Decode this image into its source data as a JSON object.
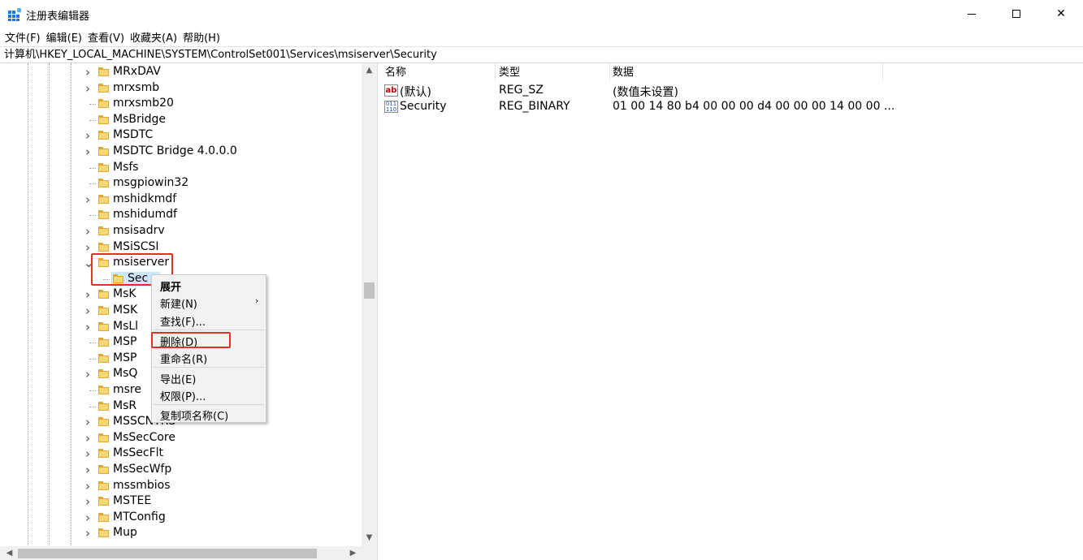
{
  "window": {
    "title": "注册表编辑器"
  },
  "menu": [
    {
      "label": "文件(F)"
    },
    {
      "label": "编辑(E)"
    },
    {
      "label": "查看(V)"
    },
    {
      "label": "收藏夹(A)"
    },
    {
      "label": "帮助(H)"
    }
  ],
  "address": "计算机\\HKEY_LOCAL_MACHINE\\SYSTEM\\ControlSet001\\Services\\msiserver\\Security",
  "tree": {
    "nodes": [
      {
        "label": "MRxDAV",
        "expander": "›"
      },
      {
        "label": "mrxsmb",
        "expander": "›"
      },
      {
        "label": "mrxsmb20",
        "expander": ""
      },
      {
        "label": "MsBridge",
        "expander": ""
      },
      {
        "label": "MSDTC",
        "expander": "›"
      },
      {
        "label": "MSDTC Bridge 4.0.0.0",
        "expander": "›"
      },
      {
        "label": "Msfs",
        "expander": ""
      },
      {
        "label": "msgpiowin32",
        "expander": ""
      },
      {
        "label": "mshidkmdf",
        "expander": "›"
      },
      {
        "label": "mshidumdf",
        "expander": ""
      },
      {
        "label": "msisadrv",
        "expander": "›"
      },
      {
        "label": "MSiSCSI",
        "expander": "›"
      },
      {
        "label": "msiserver",
        "expander": "⌄"
      },
      {
        "label": "Sec",
        "expander": "",
        "child": true,
        "selected": true
      },
      {
        "label": "MsK",
        "expander": "›"
      },
      {
        "label": "MSK",
        "expander": "›"
      },
      {
        "label": "MsLl",
        "expander": "›"
      },
      {
        "label": "MSP",
        "expander": ""
      },
      {
        "label": "MSP",
        "expander": ""
      },
      {
        "label": "MsQ",
        "expander": "›"
      },
      {
        "label": "msre",
        "expander": ""
      },
      {
        "label": "MsR",
        "expander": ""
      },
      {
        "label": "MSSCNTRS",
        "expander": "›"
      },
      {
        "label": "MsSecCore",
        "expander": "›"
      },
      {
        "label": "MsSecFlt",
        "expander": "›"
      },
      {
        "label": "MsSecWfp",
        "expander": "›"
      },
      {
        "label": "mssmbios",
        "expander": "›"
      },
      {
        "label": "MSTEE",
        "expander": "›"
      },
      {
        "label": "MTConfig",
        "expander": "›"
      },
      {
        "label": "Mup",
        "expander": "›"
      }
    ]
  },
  "list": {
    "columns": [
      "名称",
      "类型",
      "数据"
    ],
    "rows": [
      {
        "name": "(默认)",
        "type": "REG_SZ",
        "data": "(数值未设置)",
        "icon": "string-value-icon"
      },
      {
        "name": "Security",
        "type": "REG_BINARY",
        "data": "01 00 14 80 b4 00 00 00 d4 00 00 00 14 00 00 ...",
        "icon": "binary-value-icon"
      }
    ]
  },
  "context_menu": {
    "items": [
      {
        "label": "展开"
      },
      {
        "label": "新建(N)",
        "submenu": true
      },
      {
        "label": "查找(F)..."
      },
      {
        "label": "删除(D)"
      },
      {
        "label": "重命名(R)"
      },
      {
        "label": "导出(E)"
      },
      {
        "label": "权限(P)..."
      },
      {
        "label": "复制项名称(C)"
      }
    ]
  },
  "icons": {
    "app": "registry-editor-icon",
    "folder": "folder-icon",
    "sz_glyph": "ab",
    "bin_glyph": "011 110"
  },
  "colors": {
    "highlight_box": "#e03127",
    "selection": "#cce8ff",
    "folder": "#f8d775"
  }
}
